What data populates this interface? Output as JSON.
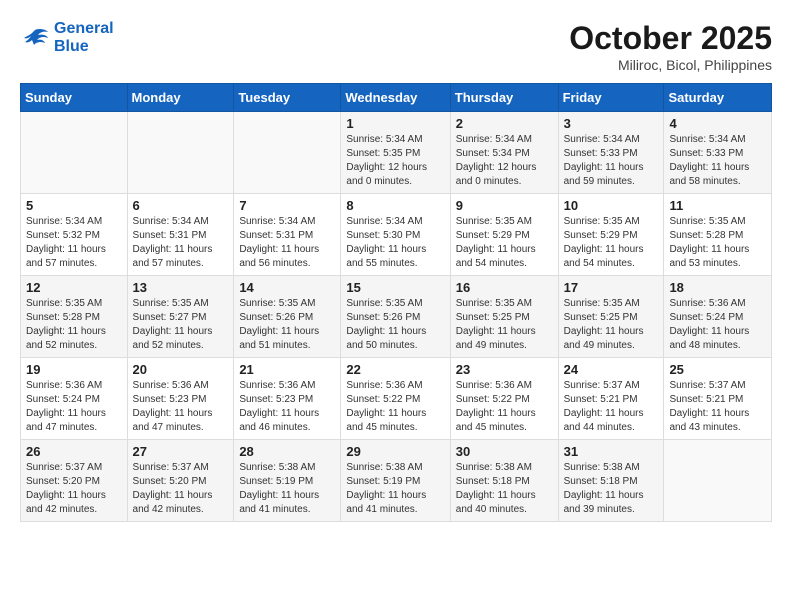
{
  "header": {
    "logo_line1": "General",
    "logo_line2": "Blue",
    "month": "October 2025",
    "location": "Miliroc, Bicol, Philippines"
  },
  "weekdays": [
    "Sunday",
    "Monday",
    "Tuesday",
    "Wednesday",
    "Thursday",
    "Friday",
    "Saturday"
  ],
  "weeks": [
    [
      {
        "day": "",
        "info": ""
      },
      {
        "day": "",
        "info": ""
      },
      {
        "day": "",
        "info": ""
      },
      {
        "day": "1",
        "info": "Sunrise: 5:34 AM\nSunset: 5:35 PM\nDaylight: 12 hours\nand 0 minutes."
      },
      {
        "day": "2",
        "info": "Sunrise: 5:34 AM\nSunset: 5:34 PM\nDaylight: 12 hours\nand 0 minutes."
      },
      {
        "day": "3",
        "info": "Sunrise: 5:34 AM\nSunset: 5:33 PM\nDaylight: 11 hours\nand 59 minutes."
      },
      {
        "day": "4",
        "info": "Sunrise: 5:34 AM\nSunset: 5:33 PM\nDaylight: 11 hours\nand 58 minutes."
      }
    ],
    [
      {
        "day": "5",
        "info": "Sunrise: 5:34 AM\nSunset: 5:32 PM\nDaylight: 11 hours\nand 57 minutes."
      },
      {
        "day": "6",
        "info": "Sunrise: 5:34 AM\nSunset: 5:31 PM\nDaylight: 11 hours\nand 57 minutes."
      },
      {
        "day": "7",
        "info": "Sunrise: 5:34 AM\nSunset: 5:31 PM\nDaylight: 11 hours\nand 56 minutes."
      },
      {
        "day": "8",
        "info": "Sunrise: 5:34 AM\nSunset: 5:30 PM\nDaylight: 11 hours\nand 55 minutes."
      },
      {
        "day": "9",
        "info": "Sunrise: 5:35 AM\nSunset: 5:29 PM\nDaylight: 11 hours\nand 54 minutes."
      },
      {
        "day": "10",
        "info": "Sunrise: 5:35 AM\nSunset: 5:29 PM\nDaylight: 11 hours\nand 54 minutes."
      },
      {
        "day": "11",
        "info": "Sunrise: 5:35 AM\nSunset: 5:28 PM\nDaylight: 11 hours\nand 53 minutes."
      }
    ],
    [
      {
        "day": "12",
        "info": "Sunrise: 5:35 AM\nSunset: 5:28 PM\nDaylight: 11 hours\nand 52 minutes."
      },
      {
        "day": "13",
        "info": "Sunrise: 5:35 AM\nSunset: 5:27 PM\nDaylight: 11 hours\nand 52 minutes."
      },
      {
        "day": "14",
        "info": "Sunrise: 5:35 AM\nSunset: 5:26 PM\nDaylight: 11 hours\nand 51 minutes."
      },
      {
        "day": "15",
        "info": "Sunrise: 5:35 AM\nSunset: 5:26 PM\nDaylight: 11 hours\nand 50 minutes."
      },
      {
        "day": "16",
        "info": "Sunrise: 5:35 AM\nSunset: 5:25 PM\nDaylight: 11 hours\nand 49 minutes."
      },
      {
        "day": "17",
        "info": "Sunrise: 5:35 AM\nSunset: 5:25 PM\nDaylight: 11 hours\nand 49 minutes."
      },
      {
        "day": "18",
        "info": "Sunrise: 5:36 AM\nSunset: 5:24 PM\nDaylight: 11 hours\nand 48 minutes."
      }
    ],
    [
      {
        "day": "19",
        "info": "Sunrise: 5:36 AM\nSunset: 5:24 PM\nDaylight: 11 hours\nand 47 minutes."
      },
      {
        "day": "20",
        "info": "Sunrise: 5:36 AM\nSunset: 5:23 PM\nDaylight: 11 hours\nand 47 minutes."
      },
      {
        "day": "21",
        "info": "Sunrise: 5:36 AM\nSunset: 5:23 PM\nDaylight: 11 hours\nand 46 minutes."
      },
      {
        "day": "22",
        "info": "Sunrise: 5:36 AM\nSunset: 5:22 PM\nDaylight: 11 hours\nand 45 minutes."
      },
      {
        "day": "23",
        "info": "Sunrise: 5:36 AM\nSunset: 5:22 PM\nDaylight: 11 hours\nand 45 minutes."
      },
      {
        "day": "24",
        "info": "Sunrise: 5:37 AM\nSunset: 5:21 PM\nDaylight: 11 hours\nand 44 minutes."
      },
      {
        "day": "25",
        "info": "Sunrise: 5:37 AM\nSunset: 5:21 PM\nDaylight: 11 hours\nand 43 minutes."
      }
    ],
    [
      {
        "day": "26",
        "info": "Sunrise: 5:37 AM\nSunset: 5:20 PM\nDaylight: 11 hours\nand 42 minutes."
      },
      {
        "day": "27",
        "info": "Sunrise: 5:37 AM\nSunset: 5:20 PM\nDaylight: 11 hours\nand 42 minutes."
      },
      {
        "day": "28",
        "info": "Sunrise: 5:38 AM\nSunset: 5:19 PM\nDaylight: 11 hours\nand 41 minutes."
      },
      {
        "day": "29",
        "info": "Sunrise: 5:38 AM\nSunset: 5:19 PM\nDaylight: 11 hours\nand 41 minutes."
      },
      {
        "day": "30",
        "info": "Sunrise: 5:38 AM\nSunset: 5:18 PM\nDaylight: 11 hours\nand 40 minutes."
      },
      {
        "day": "31",
        "info": "Sunrise: 5:38 AM\nSunset: 5:18 PM\nDaylight: 11 hours\nand 39 minutes."
      },
      {
        "day": "",
        "info": ""
      }
    ]
  ]
}
